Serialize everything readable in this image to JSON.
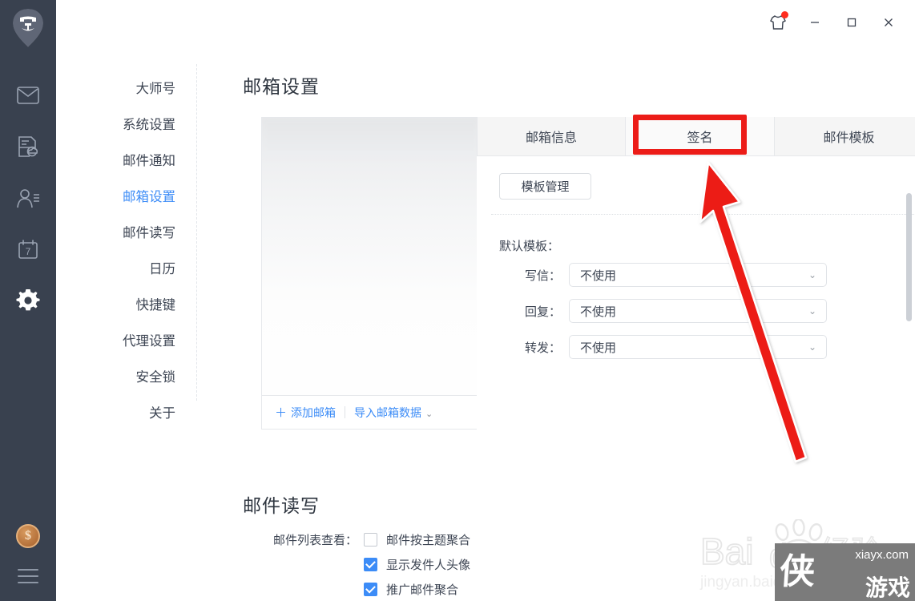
{
  "window": {
    "skin_icon": "tshirt-skin-icon",
    "has_notification_dot": true,
    "minimize_label": "—",
    "maximize_label": "☐",
    "close_label": "✕"
  },
  "rail": {
    "logo_name": "lion-avatar-logo",
    "items": [
      {
        "name": "mail-icon",
        "label": "邮件"
      },
      {
        "name": "cloud-file-icon",
        "label": "网盘"
      },
      {
        "name": "contacts-icon",
        "label": "联系人"
      },
      {
        "name": "calendar-icon",
        "label": "日历",
        "badge": "7"
      },
      {
        "name": "gear-icon",
        "label": "设置",
        "active": true
      }
    ],
    "coin_symbol": "$",
    "menu_name": "hamburger-menu-icon"
  },
  "nav": {
    "items": [
      {
        "label": "大师号",
        "active": false
      },
      {
        "label": "系统设置",
        "active": false
      },
      {
        "label": "邮件通知",
        "active": false
      },
      {
        "label": "邮箱设置",
        "active": true
      },
      {
        "label": "邮件读写",
        "active": false
      },
      {
        "label": "日历",
        "active": false
      },
      {
        "label": "快捷键",
        "active": false
      },
      {
        "label": "代理设置",
        "active": false
      },
      {
        "label": "安全锁",
        "active": false
      },
      {
        "label": "关于",
        "active": false
      }
    ]
  },
  "main": {
    "page_title": "邮箱设置",
    "mailbox_panel": {
      "add_mailbox_label": "添加邮箱",
      "add_mailbox_plus": "＋",
      "import_label": "导入邮箱数据",
      "import_chevron": "⌄"
    },
    "tabs": [
      {
        "label": "邮箱信息",
        "active": false
      },
      {
        "label": "签名",
        "active": true
      },
      {
        "label": "邮件模板",
        "active": false
      }
    ],
    "panel": {
      "template_manage_label": "模板管理",
      "default_template_label": "默认模板：",
      "fields": [
        {
          "label": "写信：",
          "value": "不使用"
        },
        {
          "label": "回复：",
          "value": "不使用"
        },
        {
          "label": "转发：",
          "value": "不使用"
        }
      ],
      "chevron": "⌄"
    },
    "section2": {
      "title": "邮件读写",
      "row_label": "邮件列表查看：",
      "checkboxes": [
        {
          "label": "邮件按主题聚合",
          "checked": false
        },
        {
          "label": "显示发件人头像",
          "checked": true
        },
        {
          "label": "推广邮件聚合",
          "checked": true
        }
      ]
    }
  },
  "annotations": {
    "highlight_target": "签名",
    "highlight_color": "#ec1c18",
    "arrow_color": "#ec1c18"
  },
  "watermarks": {
    "baidu_main": "Bai",
    "baidu_du": "du",
    "baidu_cn": "经验",
    "baidu_sub": "jingyan.baidu.com",
    "site": "xiayx.com",
    "brand_big": "侠",
    "brand_small": "游戏"
  },
  "colors": {
    "rail_bg": "#39414f",
    "accent_blue": "#3c8cf7",
    "text_primary": "#3e4654",
    "annotation_red": "#ec1c18",
    "coin_gold": "#b5713a"
  }
}
